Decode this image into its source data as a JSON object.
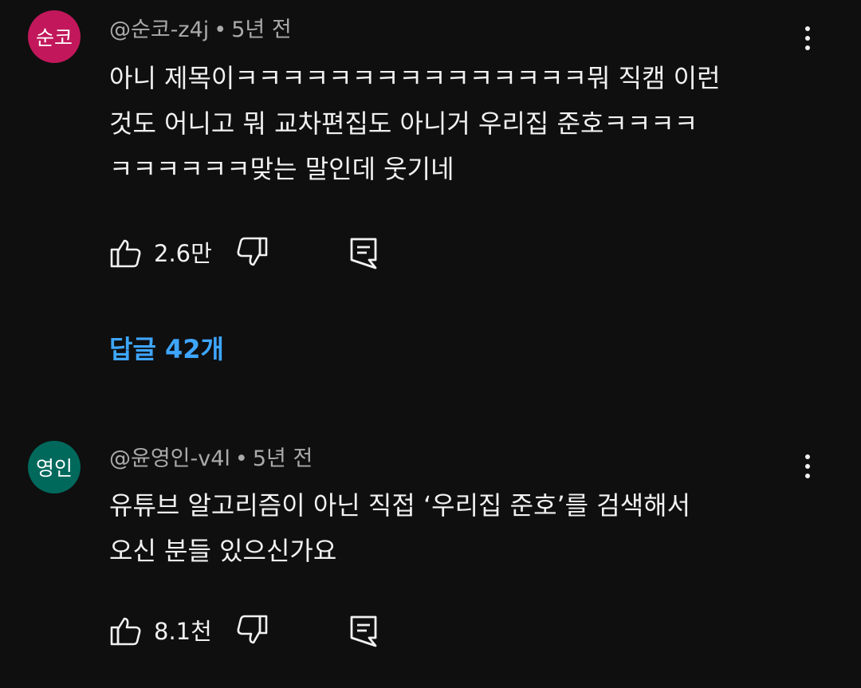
{
  "comments": [
    {
      "avatar_text": "순코",
      "avatar_color": "#c2185b",
      "handle": "@순코-z4j",
      "separator": "•",
      "time": "5년 전",
      "lines": [
        "아니 제목이ㅋㅋㅋㅋㅋㅋㅋㅋㅋㅋㅋㅋㅋㅋㅋ뭐 직캠 이런",
        "것도 어니고 뭐 교차편집도 아니거 우리집 준호ㅋㅋㅋㅋ",
        "ㅋㅋㅋㅋㅋㅋ맞는 말인데 웃기네"
      ],
      "like_count": "2.6만",
      "icons": {
        "like": "thumbs-up-icon",
        "dislike": "thumbs-down-icon",
        "reply": "reply-comment-icon",
        "more": "more-vertical-icon"
      }
    },
    {
      "avatar_text": "영인",
      "avatar_color": "#00695c",
      "handle": "@윤영인-v4l",
      "separator": "•",
      "time": "5년 전",
      "lines": [
        "유튜브 알고리즘이 아닌 직접 ‘우리집 준호’를 검색해서",
        "오신 분들 있으신가요"
      ],
      "like_count": "8.1천",
      "icons": {
        "like": "thumbs-up-icon",
        "dislike": "thumbs-down-icon",
        "reply": "reply-comment-icon",
        "more": "more-vertical-icon"
      }
    }
  ],
  "replies_link": "답글 42개",
  "colors": {
    "background": "#0f0f0f",
    "text": "#f1f1f1",
    "meta": "#aaaaaa",
    "link": "#3ea6ff"
  }
}
